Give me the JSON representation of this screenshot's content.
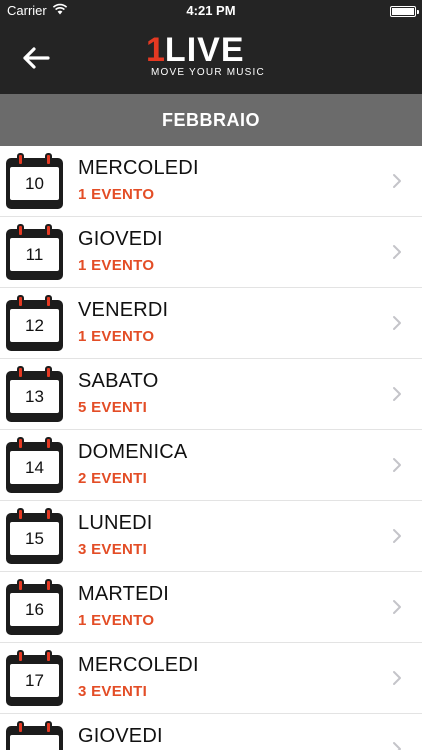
{
  "status_bar": {
    "carrier": "Carrier",
    "time": "4:21 PM",
    "icons": [
      "wifi-icon",
      "battery-icon"
    ]
  },
  "nav": {
    "back_icon": "arrow-left-icon",
    "logo_one": "1",
    "logo_live": "LIVE",
    "logo_tagline": "MOVE YOUR MUSIC"
  },
  "month": "FEBBRAIO",
  "days": [
    {
      "date": "10",
      "name": "MERCOLEDI",
      "events": "1 EVENTO"
    },
    {
      "date": "11",
      "name": "GIOVEDI",
      "events": "1 EVENTO"
    },
    {
      "date": "12",
      "name": "VENERDI",
      "events": "1 EVENTO"
    },
    {
      "date": "13",
      "name": "SABATO",
      "events": "5 EVENTI"
    },
    {
      "date": "14",
      "name": "DOMENICA",
      "events": "2 EVENTI"
    },
    {
      "date": "15",
      "name": "LUNEDI",
      "events": "3 EVENTI"
    },
    {
      "date": "16",
      "name": "MARTEDI",
      "events": "1 EVENTO"
    },
    {
      "date": "17",
      "name": "MERCOLEDI",
      "events": "3 EVENTI"
    },
    {
      "date": "",
      "name": "GIOVEDI",
      "events": ""
    }
  ],
  "colors": {
    "accent": "#e34d26",
    "nav_background": "#242424",
    "month_header": "#6b6b6b"
  }
}
